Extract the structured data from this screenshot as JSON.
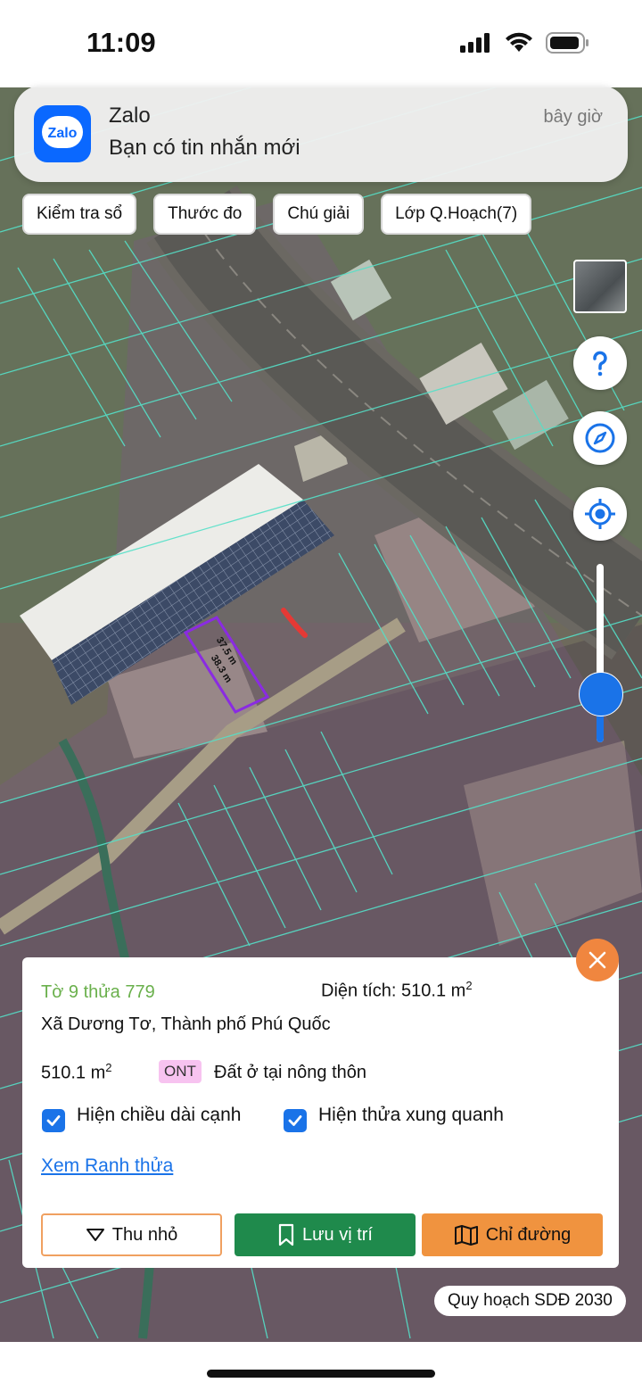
{
  "status_bar": {
    "time": "11:09",
    "icons": [
      "signal-icon",
      "wifi-icon",
      "battery-icon"
    ]
  },
  "notification": {
    "app": "Zalo",
    "logo_text": "Zalo",
    "time": "bây giờ",
    "message": "Bạn có tin nhắn mới"
  },
  "toolbar": {
    "chips": [
      "Kiểm tra sổ",
      "Thước đo",
      "Chú giải",
      "Lớp Q.Hoạch(7)"
    ]
  },
  "map": {
    "edge_labels": [
      "37.5 m",
      "38.3 m"
    ],
    "colors": {
      "parcel_lines": "#55e0c8",
      "selected_parcel": "#8a2be2",
      "planning_zone": "#7a5a80"
    }
  },
  "side_controls": [
    "layer-thumbnail",
    "help-icon",
    "compass-icon",
    "locate-icon",
    "zoom-slider"
  ],
  "panel": {
    "parcel": "Tờ 9 thửa 779",
    "area_label": "Diện tích: 510.1 m",
    "area_sup": "2",
    "address": "Xã Dương Tơ, Thành phố Phú Quốc",
    "size": "510.1 m",
    "size_sup": "2",
    "badge": "ONT",
    "land_type": "Đất ở tại nông thôn",
    "checkbox_edges": "Hiện chiều dài cạnh",
    "checkbox_neighbors": "Hiện thửa xung quanh",
    "link": "Xem Ranh thửa",
    "btn_collapse": "Thu nhỏ",
    "btn_save": "Lưu vị trí",
    "btn_directions": "Chỉ đường"
  },
  "plan_label": "Quy hoạch SDĐ 2030",
  "colors": {
    "accent": "#1a73e8",
    "save": "#1f8a4c",
    "directions": "#f0933f",
    "badge": "#f7c3f0",
    "parcel_id": "#6ab04c"
  }
}
